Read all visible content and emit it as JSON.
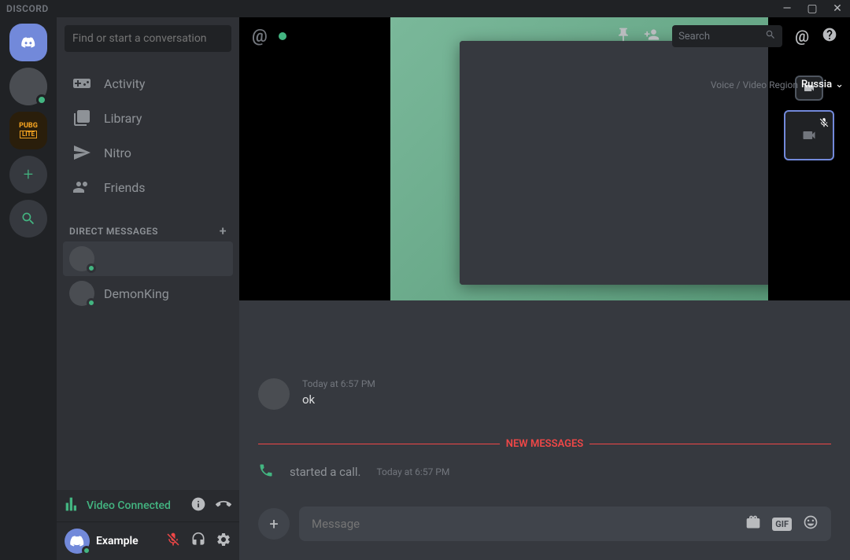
{
  "titlebar": {
    "title": "DISCORD"
  },
  "servers": {
    "pubg_top": "PUBG",
    "pubg_bottom": "LITE"
  },
  "sidebar": {
    "search_placeholder": "Find or start a conversation",
    "nav": {
      "activity": "Activity",
      "library": "Library",
      "nitro": "Nitro",
      "friends": "Friends"
    },
    "dm_header": "DIRECT MESSAGES",
    "dms": [
      {
        "name": ""
      },
      {
        "name": "DemonKing"
      }
    ]
  },
  "voice": {
    "status_label": "Video Connected"
  },
  "user": {
    "name": "Example"
  },
  "toolbar": {
    "search_placeholder": "Search",
    "region_label": "Voice / Video Region",
    "region_value": "Russia"
  },
  "chat": {
    "msg1": {
      "time": "Today at 6:57 PM",
      "text": "ok"
    },
    "divider": "NEW MESSAGES",
    "call": {
      "text": "started a call.",
      "time": "Today at 6:57 PM"
    }
  },
  "input": {
    "placeholder": "Message",
    "gif": "GIF"
  }
}
